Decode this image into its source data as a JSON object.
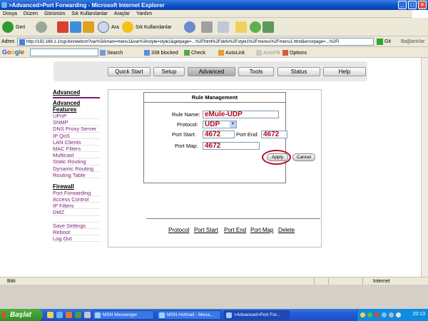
{
  "window": {
    "title": ">Advanced>Port Forwarding - Microsoft Internet Explorer",
    "buttons": [
      "_",
      "□",
      "×"
    ]
  },
  "menu": [
    "Dosya",
    "Düzen",
    "Görünüm",
    "Sık Kullanılanlar",
    "Araçlar",
    "Yardım"
  ],
  "toolbar": {
    "back": "Geri",
    "search": "Ara",
    "favorites": "Sık Kullanılanlar"
  },
  "address": {
    "label": "Adres",
    "url": "http://192.168.1.1/cgi-bin/webcm?var%3Amain=menu1&var%3Astyle=style1&getpage=...%2Fhtml%2Fdefs%2Fstyle1%2Fmenus%2Fmenu1.html&errorpage=...%2Fi",
    "go": "Git",
    "links": "Bağlantılar"
  },
  "google_bar": {
    "logo": "Google",
    "search": "Search",
    "blocked": "338 blocked",
    "check": "Check",
    "autolink": "AutoLink",
    "autofill": "AutoFill",
    "options": "Options"
  },
  "router_nav": {
    "tabs": [
      "Quick Start",
      "Setup",
      "Advanced",
      "Tools",
      "Status",
      "Help"
    ],
    "active": "Advanced"
  },
  "sidebar": {
    "heading1": "Advanced",
    "heading2a": "Advanced",
    "heading2b": "Features",
    "features": [
      "UPnP",
      "SNMP",
      "DNS Proxy Server",
      "IP QoS",
      "LAN Clients",
      "MAC Filters",
      "Multicast",
      "Static Routing",
      "Dynamic Routing",
      "Routing Table"
    ],
    "heading3": "Firewall",
    "firewall": [
      "Port Forwarding",
      "Access Control",
      "IP Filters",
      "DMZ"
    ],
    "bottom": [
      "Save Settings",
      "Reboot",
      "Log Out"
    ]
  },
  "rule": {
    "header": "Rule Management",
    "rule_name_label": "Rule Name:",
    "rule_name": "eMule-UDP",
    "protocol_label": "Protocol:",
    "protocol": "UDP",
    "port_start_label": "Port Start:",
    "port_start": "4672",
    "port_end_label": "Port End:",
    "port_end": "4672",
    "port_map_label": "Port Map:",
    "port_map": "4672",
    "apply": "Apply",
    "cancel": "Cancel"
  },
  "table_headers": [
    "Protocol",
    "Port Start",
    "Port End",
    "Port Map",
    "Delete"
  ],
  "status": {
    "left": "Bitti",
    "zone": "Internet"
  },
  "taskbar": {
    "start": "Başlat",
    "tasks": [
      "MSN Messenger",
      "MSN Hotmail - Mesa...",
      ">Advanced>Port For..."
    ],
    "clock": "20:13"
  },
  "colors": {
    "link_purple": "#7a1e74",
    "value_red": "#b3071f",
    "highlight_circle": "#b0102a"
  }
}
